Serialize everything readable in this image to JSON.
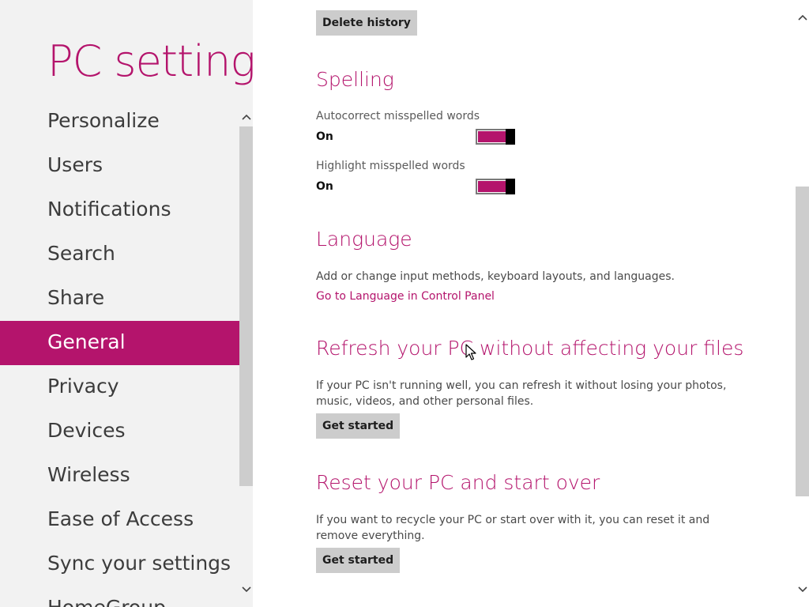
{
  "app": {
    "title": "PC settings"
  },
  "nav": {
    "items": [
      {
        "label": "Personalize"
      },
      {
        "label": "Users"
      },
      {
        "label": "Notifications"
      },
      {
        "label": "Search"
      },
      {
        "label": "Share"
      },
      {
        "label": "General",
        "selected": true
      },
      {
        "label": "Privacy"
      },
      {
        "label": "Devices"
      },
      {
        "label": "Wireless"
      },
      {
        "label": "Ease of Access"
      },
      {
        "label": "Sync your settings"
      },
      {
        "label": "HomeGroup"
      }
    ]
  },
  "history": {
    "delete_label": "Delete history"
  },
  "spelling": {
    "heading": "Spelling",
    "autocorrect": {
      "label": "Autocorrect misspelled words",
      "state": "On"
    },
    "highlight": {
      "label": "Highlight misspelled words",
      "state": "On"
    }
  },
  "language": {
    "heading": "Language",
    "description": "Add or change input methods, keyboard layouts, and languages.",
    "link": "Go to Language in Control Panel"
  },
  "refresh": {
    "heading": "Refresh your PC without affecting your files",
    "description": "If your PC isn't running well, you can refresh it without losing your photos, music, videos, and other personal files.",
    "button": "Get started"
  },
  "reset": {
    "heading": "Reset your PC and start over",
    "description": "If you want to recycle your PC or start over with it, you can reset it and remove everything.",
    "button": "Get started"
  },
  "colors": {
    "accent": "#b4146c",
    "left_pane_bg": "#f2f2f2",
    "button_bg": "#cccccc"
  },
  "icons": {
    "scroll_up": "chevron-up-icon",
    "scroll_down": "chevron-down-icon",
    "cursor": "mouse-pointer-icon"
  }
}
